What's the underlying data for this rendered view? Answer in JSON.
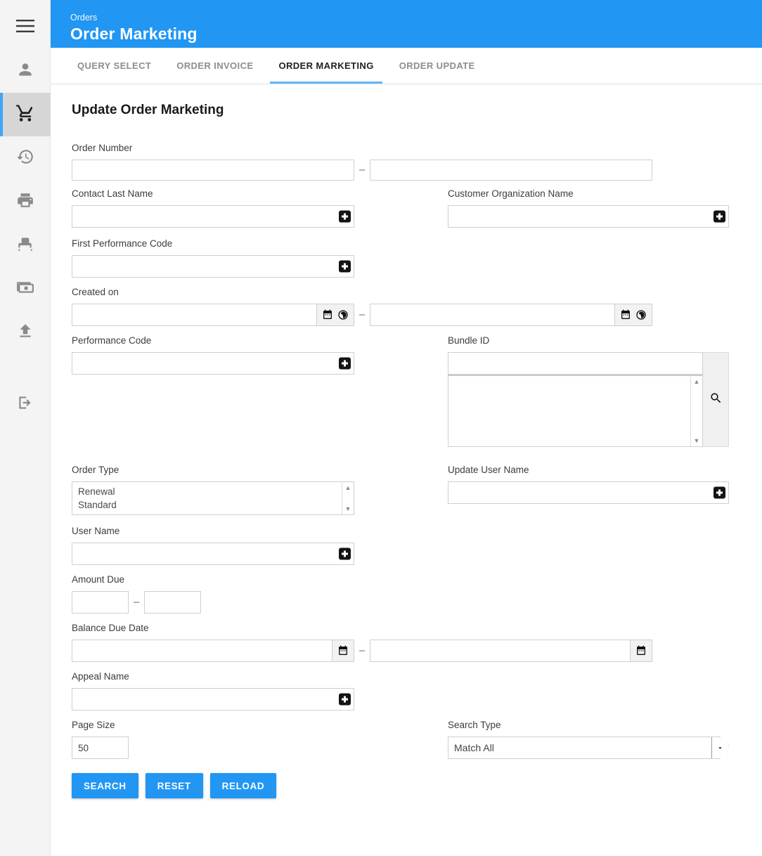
{
  "theme": {
    "accent": "#2196f3",
    "tab_underline": "#64b5f6",
    "required_star": "#ff5252"
  },
  "sidebar": {
    "items": [
      {
        "name": "menu",
        "icon": "hamburger-icon",
        "active": false
      },
      {
        "name": "account",
        "icon": "person-icon",
        "active": false
      },
      {
        "name": "orders",
        "icon": "shopping-cart-icon",
        "active": true
      },
      {
        "name": "history",
        "icon": "history-icon",
        "active": false
      },
      {
        "name": "print",
        "icon": "printer-icon",
        "active": false
      },
      {
        "name": "seating",
        "icon": "seat-icon",
        "active": false
      },
      {
        "name": "payments",
        "icon": "money-icon",
        "active": false
      },
      {
        "name": "upload",
        "icon": "upload-icon",
        "active": false
      },
      {
        "name": "logout",
        "icon": "exit-icon",
        "active": false
      }
    ]
  },
  "header": {
    "breadcrumb": "Orders",
    "title": "Order Marketing"
  },
  "tabs": [
    {
      "label": "QUERY SELECT",
      "active": false
    },
    {
      "label": "ORDER INVOICE",
      "active": false
    },
    {
      "label": "ORDER MARKETING",
      "active": true
    },
    {
      "label": "ORDER UPDATE",
      "active": false
    }
  ],
  "main": {
    "page_title": "Update Order Marketing",
    "range_separator": "–",
    "fields": {
      "order_number": {
        "label": "Order Number",
        "from": "",
        "to": "",
        "placeholder": ""
      },
      "contact_last_name": {
        "label": "Contact Last Name",
        "value": "",
        "placeholder": ""
      },
      "customer_organization_name": {
        "label": "Customer Organization Name",
        "value": "",
        "placeholder": ""
      },
      "first_performance_code": {
        "label": "First Performance Code",
        "value": "",
        "placeholder": ""
      },
      "created_on": {
        "label": "Created on",
        "from": "",
        "to": "",
        "placeholder": ""
      },
      "performance_code": {
        "label": "Performance Code",
        "value": "",
        "placeholder": ""
      },
      "bundle_id": {
        "label": "Bundle ID",
        "value": "",
        "placeholder": "",
        "options": []
      },
      "order_type": {
        "label": "Order Type",
        "options": [
          "Renewal",
          "Standard"
        ]
      },
      "update_user_name": {
        "label": "Update User Name",
        "value": "",
        "placeholder": ""
      },
      "user_name": {
        "label": "User Name",
        "value": "",
        "placeholder": ""
      },
      "amount_due": {
        "label": "Amount Due",
        "from": "",
        "to": "",
        "placeholder": ""
      },
      "balance_due_date": {
        "label": "Balance Due Date",
        "from": "",
        "to": "",
        "placeholder": ""
      },
      "appeal_name": {
        "label": "Appeal Name",
        "value": "",
        "placeholder": ""
      },
      "page_size": {
        "label": "Page Size",
        "value": "50",
        "placeholder": ""
      },
      "search_type": {
        "label": "Search Type",
        "value": "Match All",
        "required_marker": "*",
        "options": [
          "Match All"
        ]
      }
    },
    "buttons": {
      "search": "SEARCH",
      "reset": "RESET",
      "reload": "RELOAD"
    }
  }
}
